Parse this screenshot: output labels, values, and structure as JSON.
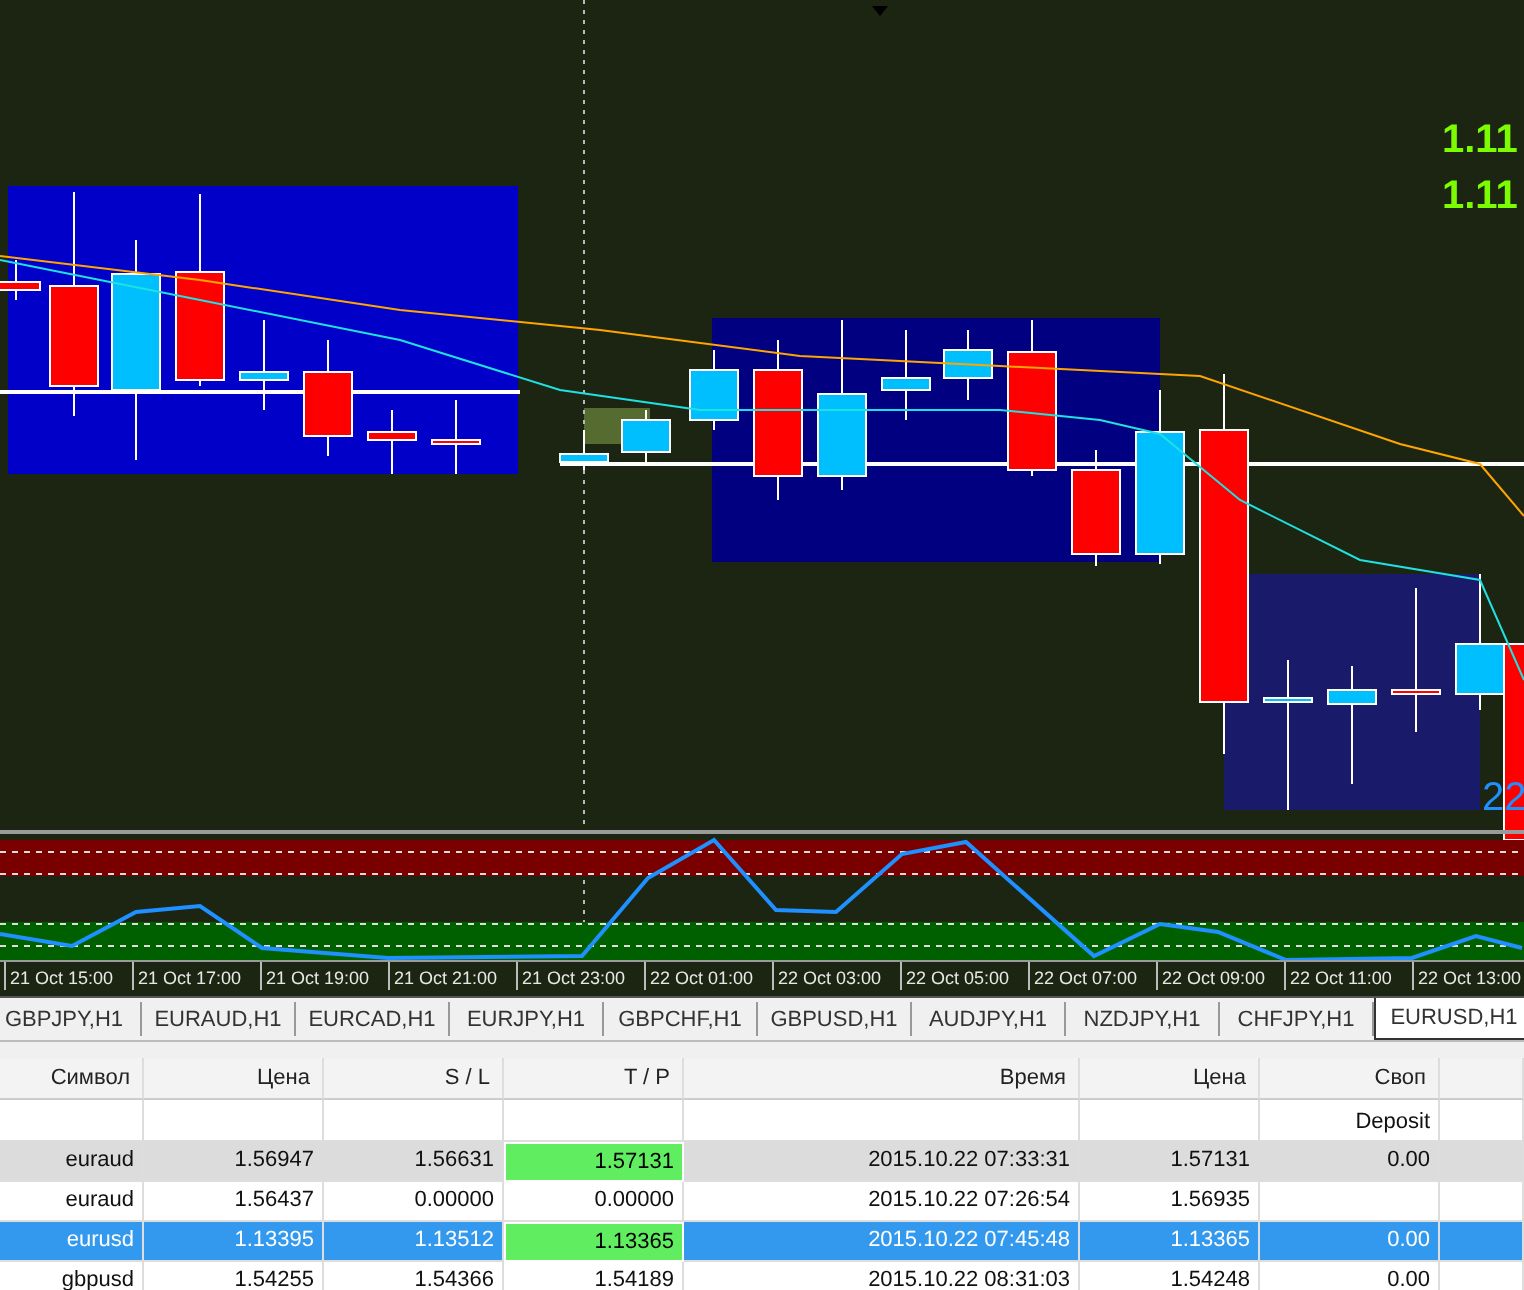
{
  "chart": {
    "price_labels": [
      "1.11",
      "1.11"
    ],
    "corner_label": "22",
    "time_axis": [
      "21 Oct 15:00",
      "21 Oct 17:00",
      "21 Oct 19:00",
      "21 Oct 21:00",
      "21 Oct 23:00",
      "22 Oct 01:00",
      "22 Oct 03:00",
      "22 Oct 05:00",
      "22 Oct 07:00",
      "22 Oct 09:00",
      "22 Oct 11:00",
      "22 Oct 13:00"
    ]
  },
  "tabs": [
    {
      "label": "GBPJPY,H1",
      "selected": false
    },
    {
      "label": "EURAUD,H1",
      "selected": false
    },
    {
      "label": "EURCAD,H1",
      "selected": false
    },
    {
      "label": "EURJPY,H1",
      "selected": false
    },
    {
      "label": "GBPCHF,H1",
      "selected": false
    },
    {
      "label": "GBPUSD,H1",
      "selected": false
    },
    {
      "label": "AUDJPY,H1",
      "selected": false
    },
    {
      "label": "NZDJPY,H1",
      "selected": false
    },
    {
      "label": "CHFJPY,H1",
      "selected": false
    },
    {
      "label": "EURUSD,H1",
      "selected": true
    }
  ],
  "table": {
    "columns": [
      "Символ",
      "Цена",
      "S / L",
      "T / P",
      "Время",
      "Цена",
      "Своп"
    ],
    "summary_row": {
      "swap": "Deposit"
    },
    "rows": [
      {
        "symbol": "euraud",
        "price": "1.56947",
        "sl": "1.56631",
        "tp": "1.57131",
        "time": "2015.10.22 07:33:31",
        "price_2": "1.57131",
        "swap": "0.00",
        "selected": false,
        "shaded": true,
        "tp_hit": true
      },
      {
        "symbol": "euraud",
        "price": "1.56437",
        "sl": "0.00000",
        "tp": "0.00000",
        "time": "2015.10.22 07:26:54",
        "price_2": "1.56935",
        "selected": false,
        "shaded": false,
        "tp_hit": false
      },
      {
        "symbol": "eurusd",
        "price": "1.13395",
        "sl": "1.13512",
        "tp": "1.13365",
        "time": "2015.10.22 07:45:48",
        "price_2": "1.13365",
        "swap": "0.00",
        "selected": true,
        "shaded": false,
        "tp_hit": true
      },
      {
        "symbol": "gbpusd",
        "price": "1.54255",
        "sl": "1.54366",
        "tp": "1.54189",
        "time": "2015.10.22 08:31:03",
        "price_2": "1.54248",
        "swap": "0.00",
        "selected": false,
        "shaded": false,
        "tp_hit": false
      }
    ]
  }
}
